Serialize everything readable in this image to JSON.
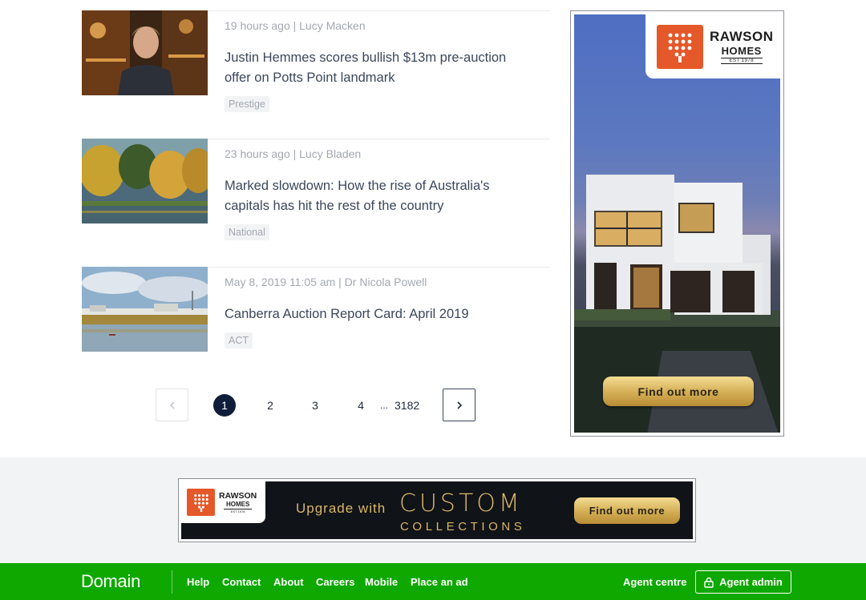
{
  "articles": [
    {
      "meta": "19 hours ago | Lucy Macken",
      "headline": "Justin Hemmes scores bullish $13m pre-auction offer on Potts Point landmark",
      "tag": "Prestige"
    },
    {
      "meta": "23 hours ago | Lucy Bladen",
      "headline": "Marked slowdown: How the rise of Australia's capitals has hit the rest of the country",
      "tag": "National"
    },
    {
      "meta": "May 8, 2019 11:05 am | Dr Nicola Powell",
      "headline": "Canberra Auction Report Card: April 2019",
      "tag": "ACT"
    }
  ],
  "pagination": {
    "pages": [
      "1",
      "2",
      "3",
      "4"
    ],
    "ellipsis": "...",
    "last": "3182",
    "current": "1"
  },
  "ad_side": {
    "brand": "RAWSON",
    "brand_sub": "HOMES",
    "brand_est": "EST 1978",
    "cta": "Find out more"
  },
  "ad_banner": {
    "brand": "RAWSON",
    "brand_sub": "HOMES",
    "brand_est": "EST 1978",
    "upgrade": "Upgrade with",
    "custom": "CUSTOM",
    "collections": "COLLECTIONS",
    "cta": "Find out more"
  },
  "footer": {
    "logo": "Domain",
    "links": [
      "Help",
      "Contact",
      "About",
      "Careers",
      "Mobile",
      "Place an ad"
    ],
    "agent_centre": "Agent centre",
    "agent_admin": "Agent admin"
  },
  "colors": {
    "footer_green": "#0ea800",
    "active_page": "#0e1e3a",
    "ad_orange": "#e4582a",
    "ad_gold": "#d3ad53"
  }
}
